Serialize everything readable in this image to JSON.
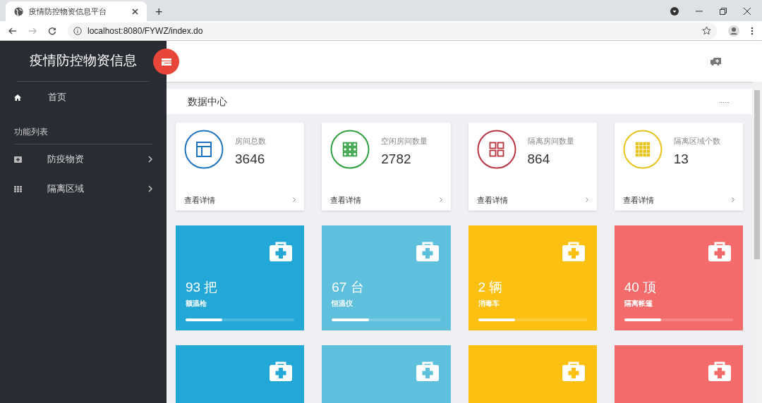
{
  "browser": {
    "tab_title": "疫情防控物资信息平台",
    "new_tab": "+",
    "url": "localhost:8080/FYWZ/index.do"
  },
  "sidebar": {
    "title": "疫情防控物资信息",
    "home": "首页",
    "section": "功能列表",
    "items": [
      {
        "label": "防疫物资",
        "kind": "kit"
      },
      {
        "label": "隔离区域",
        "kind": "grid"
      }
    ]
  },
  "breadcrumb": {
    "title": "数据中心",
    "more": "......"
  },
  "stats": [
    {
      "label": "房间总数",
      "value": "3646",
      "link": "查看详情",
      "color": "#1e73be",
      "kind": "layout"
    },
    {
      "label": "空闲房间数量",
      "value": "2782",
      "link": "查看详情",
      "color": "#2e9e3e",
      "kind": "grid9"
    },
    {
      "label": "隔离房间数量",
      "value": "864",
      "link": "查看详情",
      "color": "#b8323f",
      "kind": "grid4"
    },
    {
      "label": "隔离区域个数",
      "value": "13",
      "link": "查看详情",
      "color": "#e8c21b",
      "kind": "grid16"
    }
  ],
  "supplies": [
    {
      "amount": "93 把",
      "name": "额温枪",
      "color": "#22a7d6",
      "level": 0.34
    },
    {
      "amount": "67 台",
      "name": "恒温仪",
      "color": "#5ec0dc",
      "level": 0.34
    },
    {
      "amount": "2 辆",
      "name": "消毒车",
      "color": "#fcc012",
      "level": 0.34
    },
    {
      "amount": "40 顶",
      "name": "隔离帐篷",
      "color": "#f46b6b",
      "level": 0.34
    }
  ],
  "supplies_row2": [
    {
      "color": "#22a7d6"
    },
    {
      "color": "#5ec0dc"
    },
    {
      "color": "#fcc012"
    },
    {
      "color": "#f46b6b"
    }
  ]
}
